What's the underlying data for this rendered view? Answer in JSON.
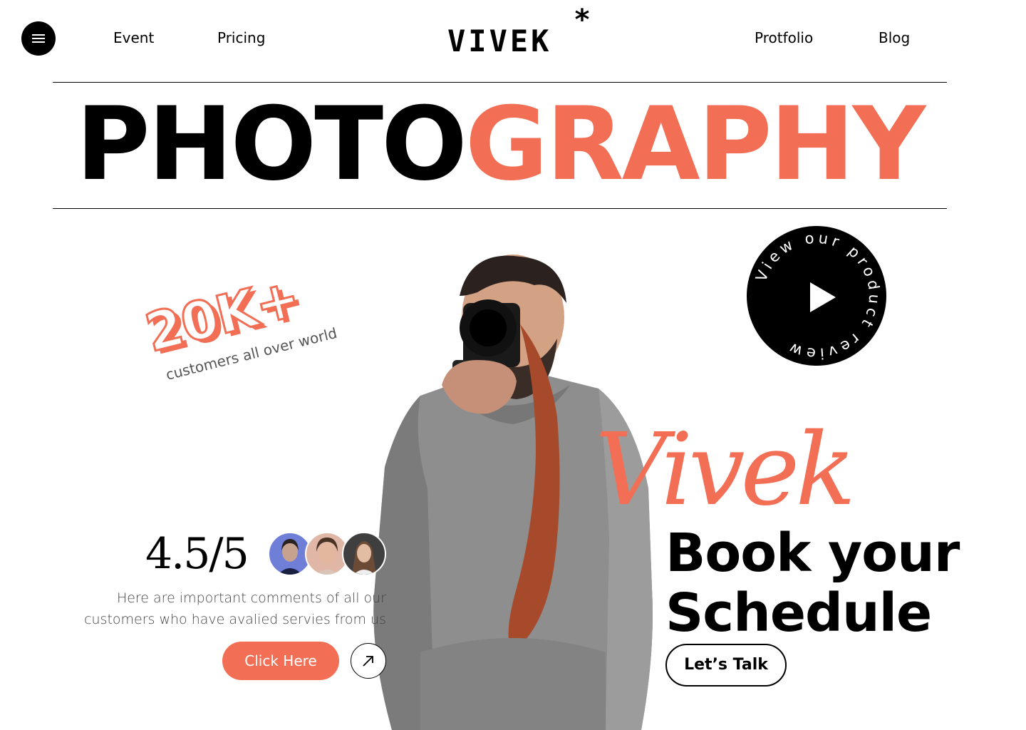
{
  "nav": {
    "left": [
      "Event",
      "Pricing"
    ],
    "right": [
      "Protfolio",
      "Blog"
    ]
  },
  "logo": {
    "text": "VIVEK",
    "mark": "*"
  },
  "hero": {
    "title_dark": "PHOTO",
    "title_accent": "GRAPHY"
  },
  "stat": {
    "value": "20K+",
    "caption": "customers all over world"
  },
  "badge": {
    "ring_text": "View our product review"
  },
  "signature": "Vivek",
  "book": {
    "line1": "Book your",
    "line2": "Schedule",
    "button": "Let’s Talk"
  },
  "rating": {
    "value": "4.5/5"
  },
  "testimonial": {
    "line1": "Here are important comments of all our",
    "line2": "customers  who have avalied servies from us",
    "button": "Click Here"
  },
  "colors": {
    "accent": "#f26f55",
    "dark": "#000000"
  },
  "icons": [
    "menu-icon",
    "play-icon",
    "arrow-up-right-icon"
  ]
}
